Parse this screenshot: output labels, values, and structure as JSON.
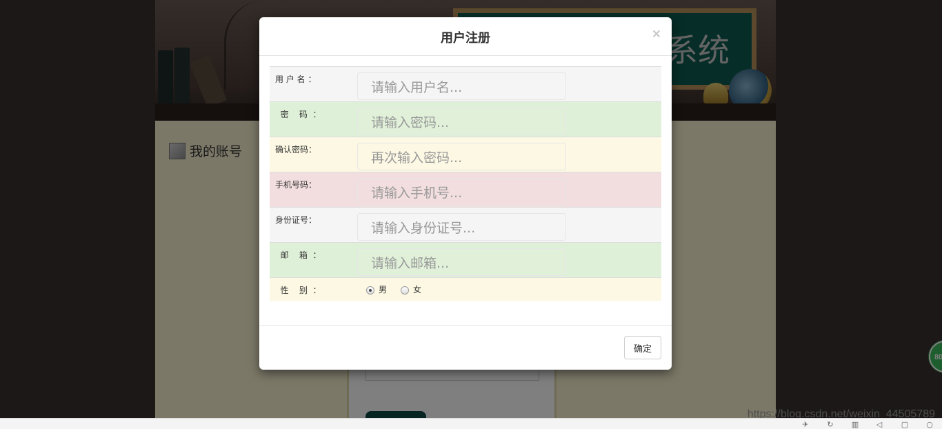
{
  "background_page": {
    "banner_title": "系统",
    "account_label": "我的账号"
  },
  "watermark": "https://blog.csdn.net/weixin_44505789",
  "badge_text": "80",
  "modal": {
    "title": "用户注册",
    "close_symbol": "×",
    "fields": [
      {
        "label": "用 户 名 ：",
        "placeholder": "请输入用户名...",
        "style": "active"
      },
      {
        "label": "  密    码  ：",
        "placeholder": "请输入密码...",
        "style": "success"
      },
      {
        "label": "确认密码：",
        "placeholder": "再次输入密码...",
        "style": "warning"
      },
      {
        "label": "手机号码：",
        "placeholder": "请输入手机号...",
        "style": "danger"
      },
      {
        "label": "身份证号：",
        "placeholder": "请输入身份证号...",
        "style": "active"
      },
      {
        "label": "  邮    箱  ：",
        "placeholder": "请输入邮箱...",
        "style": "success"
      }
    ],
    "gender": {
      "label": "  性    别  ：",
      "options": [
        "男",
        "女"
      ],
      "selected": "男"
    },
    "confirm_label": "确定"
  },
  "statusbar_icons": [
    "pin-icon",
    "refresh-icon",
    "trash-icon",
    "speaker-icon",
    "window-icon",
    "search-icon"
  ]
}
